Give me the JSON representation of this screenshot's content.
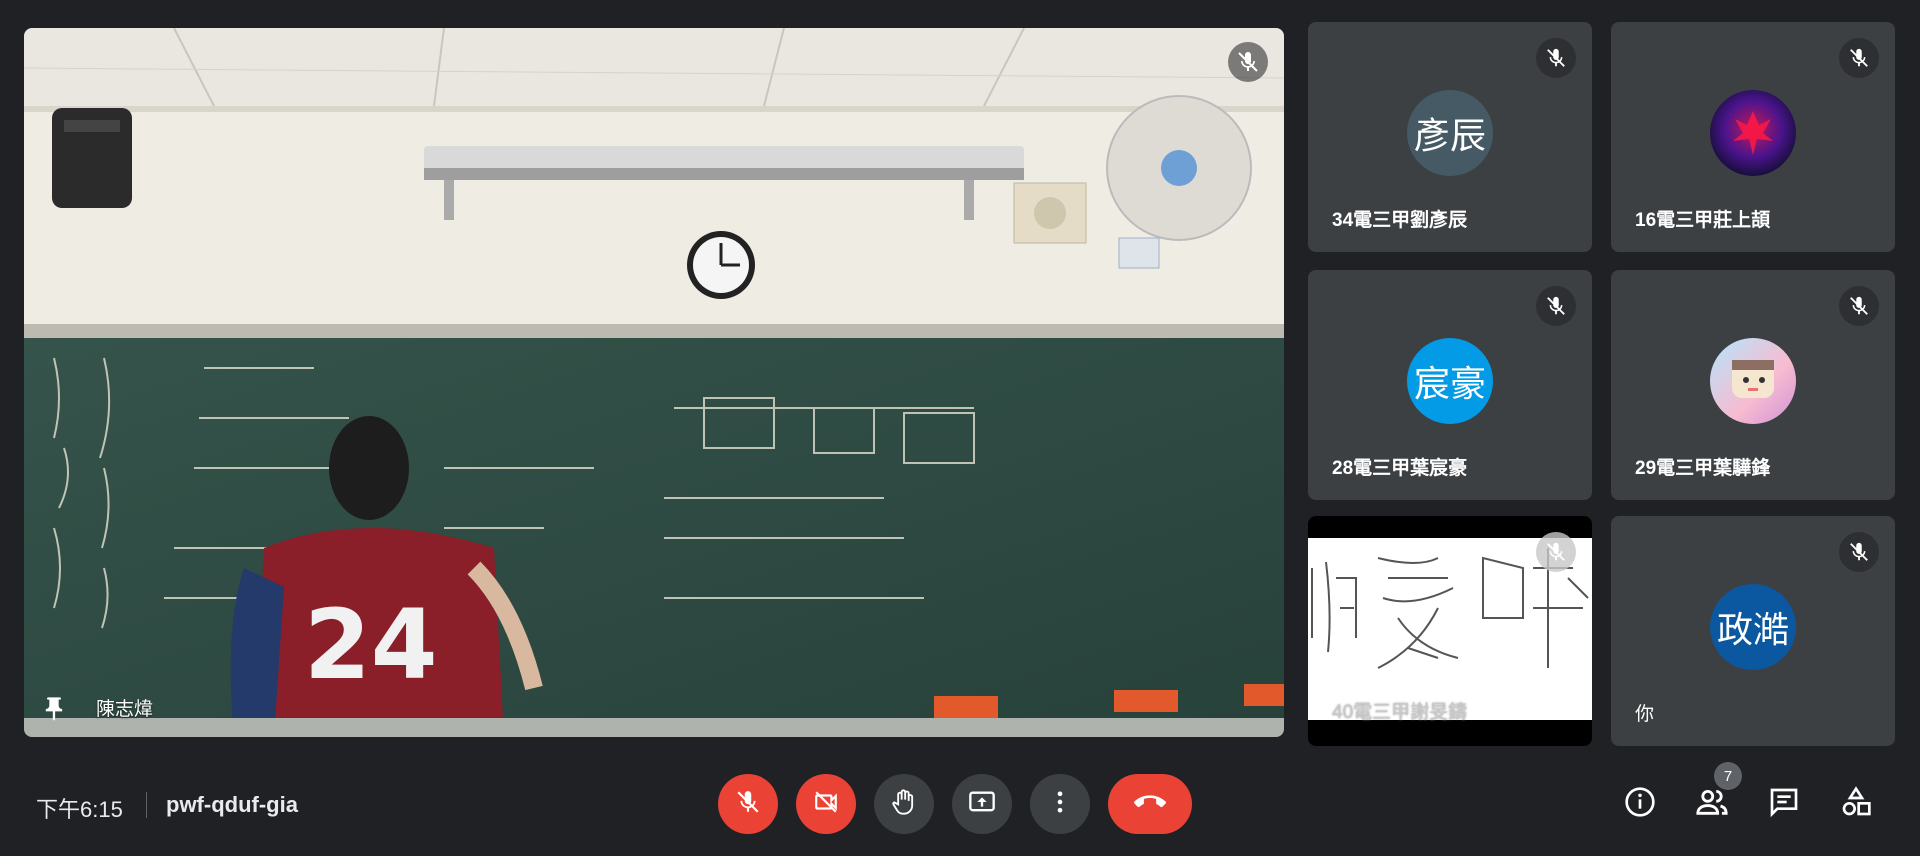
{
  "main_video": {
    "participant_name": "陳志煒",
    "pin_icon": "pin-icon",
    "mic_icon": "mic-off-icon"
  },
  "participants": [
    {
      "name": "34電三甲劉彥辰",
      "initials": "彥辰",
      "avatar_color": "#455a64",
      "avatar_type": "initials"
    },
    {
      "name": "16電三甲莊上頡",
      "initials": "",
      "avatar_color": "#1a0a2e",
      "avatar_type": "image"
    },
    {
      "name": "28電三甲葉宸豪",
      "initials": "宸豪",
      "avatar_color": "#039be5",
      "avatar_type": "initials"
    },
    {
      "name": "29電三甲葉驊鋒",
      "initials": "",
      "avatar_color": "#b39ddb",
      "avatar_type": "image"
    },
    {
      "name": "40電三甲謝旻鑄",
      "initials": "",
      "avatar_color": "#ffffff",
      "avatar_type": "video"
    },
    {
      "name": "你",
      "initials": "政澔",
      "avatar_color": "#0b57a0",
      "avatar_type": "initials"
    }
  ],
  "meeting": {
    "time": "下午6:15",
    "code": "pwf-qduf-gia"
  },
  "controls": [
    {
      "name": "mic-toggle",
      "icon": "mic-off-icon",
      "state": "off"
    },
    {
      "name": "camera-toggle",
      "icon": "videocam-off-icon",
      "state": "off"
    },
    {
      "name": "raise-hand",
      "icon": "hand-icon"
    },
    {
      "name": "present",
      "icon": "present-screen-icon"
    },
    {
      "name": "more-options",
      "icon": "more-vert-icon"
    },
    {
      "name": "leave-call",
      "icon": "call-end-icon"
    }
  ],
  "right_actions": {
    "info_icon": "info-icon",
    "people_icon": "people-icon",
    "people_count": "7",
    "chat_icon": "chat-icon",
    "activities_icon": "activities-icon"
  },
  "colors": {
    "background": "#202124",
    "tile": "#3c4043",
    "danger": "#ea4335",
    "button": "#3c4043"
  }
}
